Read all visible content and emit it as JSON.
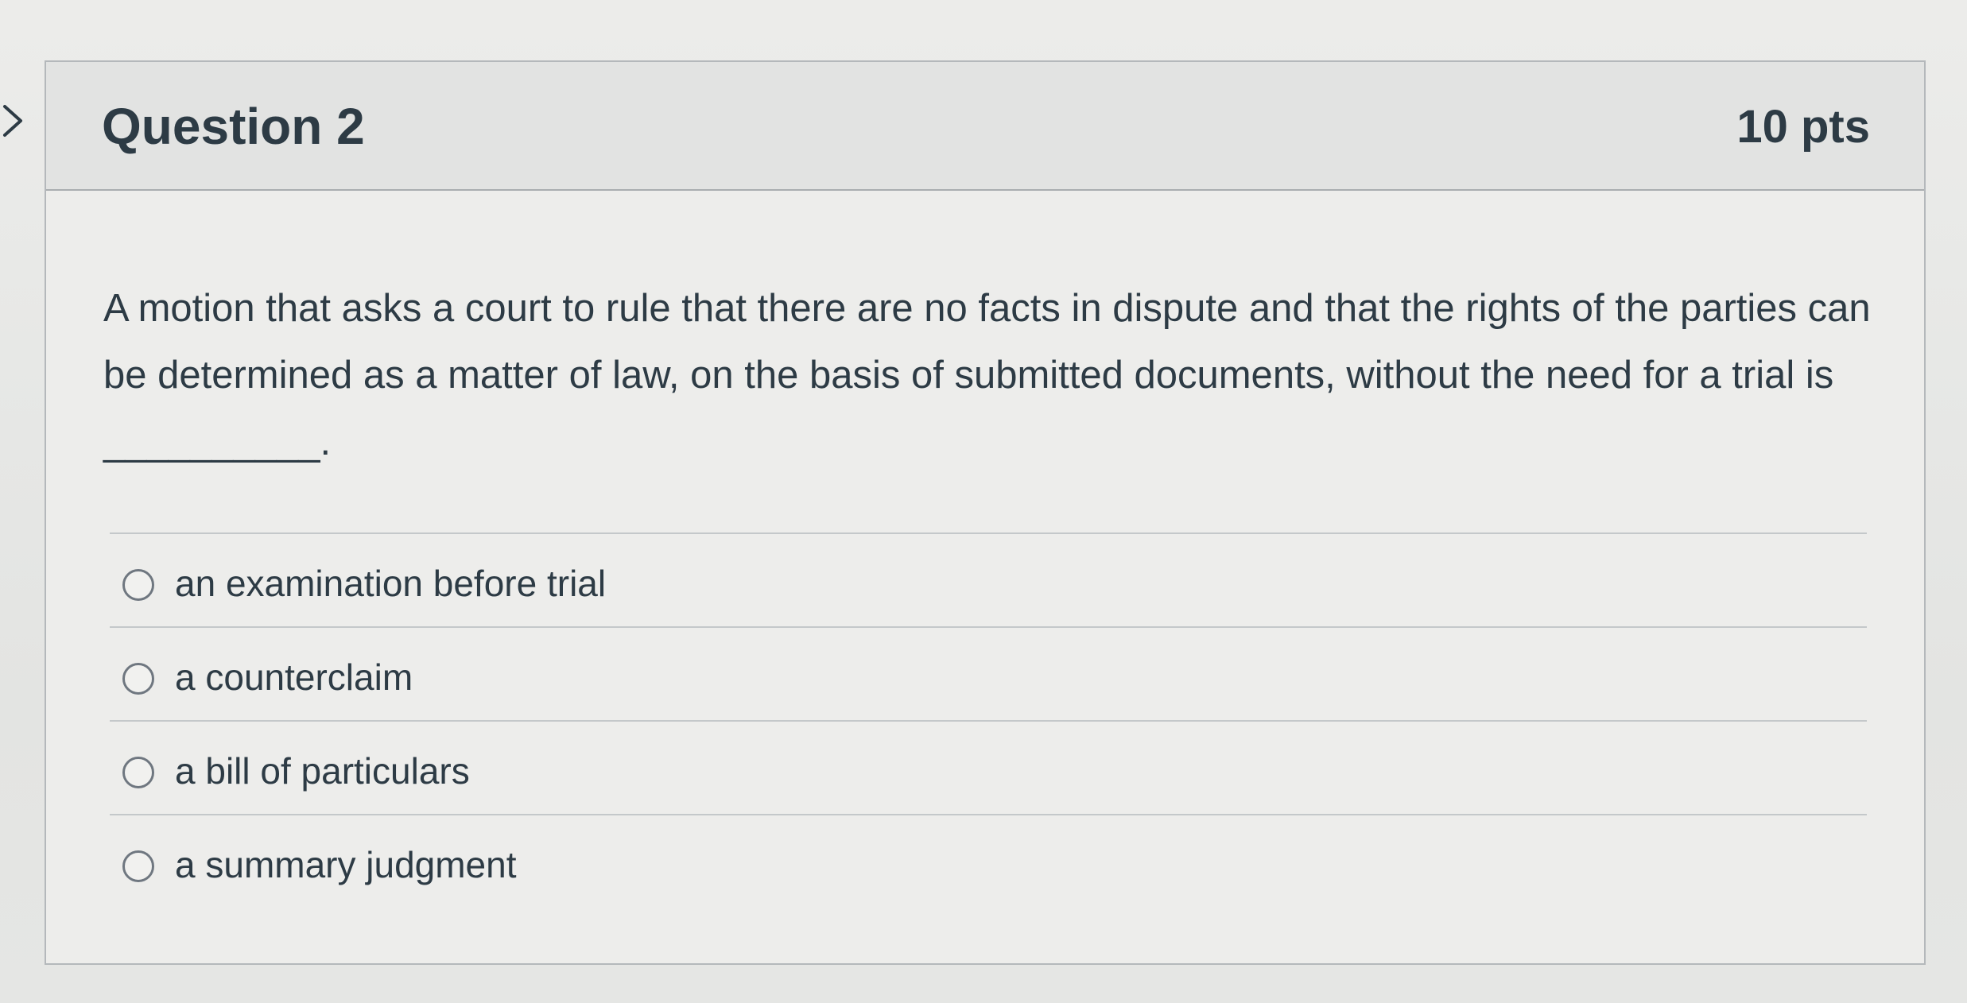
{
  "question": {
    "title": "Question 2",
    "points": "10 pts",
    "text": "A motion that asks a court to rule that there are no facts in dispute and that the rights of the parties can be determined as a matter of law, on the basis of submitted documents, without the need for a trial is __________.",
    "answers": [
      {
        "label": "an examination before trial",
        "selected": false
      },
      {
        "label": "a counterclaim",
        "selected": false
      },
      {
        "label": "a bill of particulars",
        "selected": false
      },
      {
        "label": "a summary judgment",
        "selected": false
      }
    ]
  },
  "icons": {
    "side_nav": "chevron-right-icon",
    "answer_control": "radio-button"
  },
  "colors": {
    "text": "#2d3b45",
    "border": "#b4b8bb",
    "header_background": "#e2e3e2",
    "card_background": "#ededeb"
  }
}
